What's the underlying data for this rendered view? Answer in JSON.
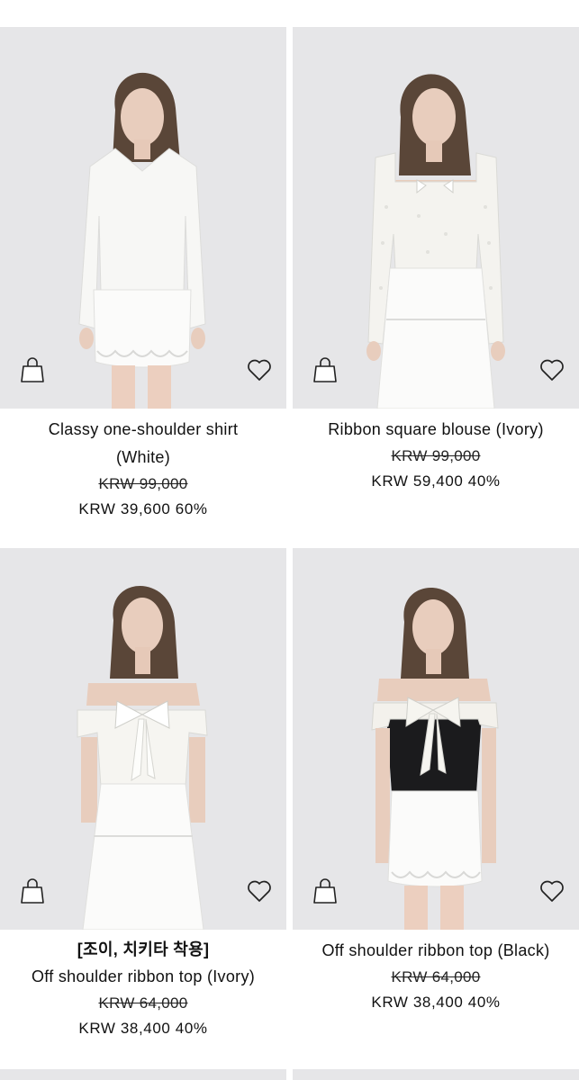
{
  "products": [
    {
      "name": "Classy one-shoulder shirt (White)",
      "name_lines": [
        "Classy one-shoulder shirt",
        "(White)"
      ],
      "original_price": "KRW 99,000",
      "sale_price": "KRW 39,600 60%",
      "image_alt": "Model wearing white one-shoulder shirt and white lace mini skirt",
      "top_color": "#f7f7f5",
      "bottom_color": "#fbfbfa"
    },
    {
      "name": "Ribbon square blouse (Ivory)",
      "name_lines": [
        "Ribbon square blouse (Ivory)"
      ],
      "original_price": "KRW 99,000",
      "sale_price": "KRW 59,400 40%",
      "image_alt": "Model wearing ivory eyelet ribbon square blouse and white tiered long skirt",
      "top_color": "#f4f3ef",
      "bottom_color": "#fbfbfa"
    },
    {
      "tagline": "[조이, 치키타 착용]",
      "name": "Off shoulder ribbon top (Ivory)",
      "name_lines": [
        "Off shoulder ribbon top (Ivory)"
      ],
      "original_price": "KRW 64,000",
      "sale_price": "KRW 38,400 40%",
      "image_alt": "Model wearing ivory off shoulder ribbon top and white tiered skirt",
      "top_color": "#f6f5f1",
      "bottom_color": "#fbfbfa"
    },
    {
      "name": "Off shoulder ribbon top (Black)",
      "name_lines": [
        "Off shoulder ribbon top (Black)"
      ],
      "original_price": "KRW 64,000",
      "sale_price": "KRW 38,400 40%",
      "image_alt": "Model wearing black off shoulder ribbon top with ivory bow and white lace mini skirt",
      "top_color": "#1b1b1d",
      "bottom_color": "#fbfbfa"
    }
  ],
  "icons": {
    "cart": "shopping-bag-icon",
    "wishlist": "heart-outline-icon"
  },
  "colors": {
    "background": "#ffffff",
    "photo_background": "#e6e6e8",
    "text": "#111111"
  }
}
